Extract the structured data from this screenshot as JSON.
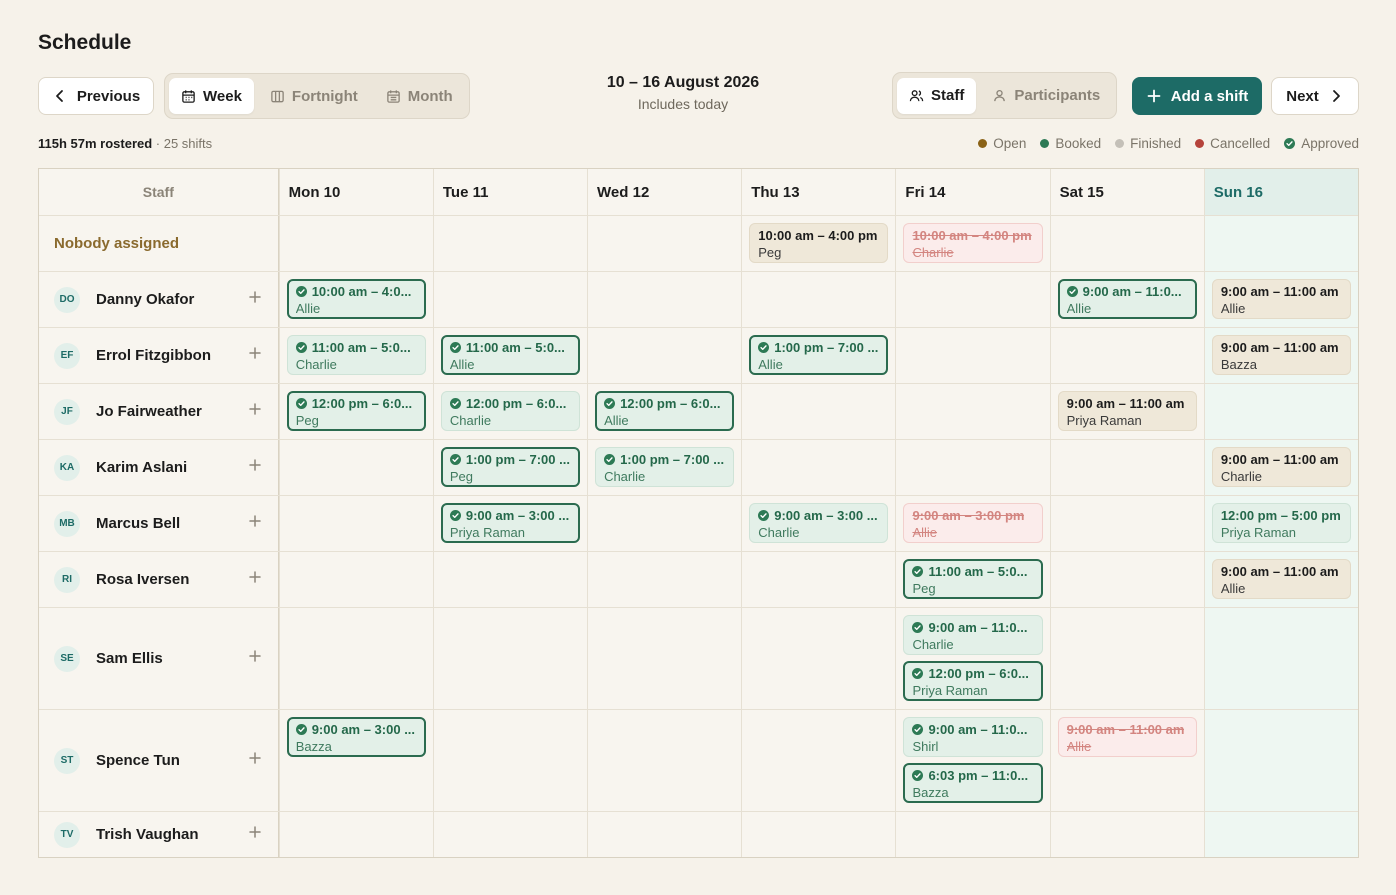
{
  "page": {
    "title": "Schedule"
  },
  "toolbar": {
    "previous_label": "Previous",
    "next_label": "Next",
    "views": [
      {
        "label": "Week",
        "icon": "calendar-icon",
        "active": true
      },
      {
        "label": "Fortnight",
        "icon": "columns-icon",
        "active": false
      },
      {
        "label": "Month",
        "icon": "calendar-grid-icon",
        "active": false
      }
    ],
    "range_title": "10 – 16 August 2026",
    "range_subtitle": "Includes today",
    "groupings": [
      {
        "label": "Staff",
        "icon": "users-icon",
        "active": true
      },
      {
        "label": "Participants",
        "icon": "user-icon",
        "active": false
      }
    ],
    "add_shift_label": "Add a shift"
  },
  "summary": {
    "hours": "115h 57m rostered",
    "shifts": " · 25 shifts"
  },
  "legend": [
    {
      "label": "Open",
      "color": "#8a6216",
      "kind": "dot"
    },
    {
      "label": "Booked",
      "color": "#2d7a55",
      "kind": "dot"
    },
    {
      "label": "Finished",
      "color": "#c4c0b8",
      "kind": "dot"
    },
    {
      "label": "Cancelled",
      "color": "#b5433b",
      "kind": "dot"
    },
    {
      "label": "Approved",
      "color": "#2d7a55",
      "kind": "check"
    }
  ],
  "grid": {
    "staff_header": "Staff",
    "days": [
      "Mon 10",
      "Tue 11",
      "Wed 12",
      "Thu 13",
      "Fri 14",
      "Sat 15",
      "Sun 16"
    ],
    "rows": [
      {
        "name": "Nobody assigned",
        "initials": "",
        "nobody": true,
        "height": 56,
        "cells": [
          [],
          [],
          [],
          [
            {
              "time": "10:00 am – 4:00 pm",
              "who": "Peg",
              "status": "open",
              "approved": false
            }
          ],
          [
            {
              "time": "10:00 am – 4:00 pm",
              "who": "Charlie",
              "status": "cancelled",
              "approved": false
            }
          ],
          [],
          []
        ]
      },
      {
        "name": "Danny Okafor",
        "initials": "DO",
        "height": 56,
        "cells": [
          [
            {
              "time": "10:00 am – 4:0...",
              "who": "Allie",
              "status": "booked",
              "approved": true,
              "selected": true
            }
          ],
          [],
          [],
          [],
          [],
          [
            {
              "time": "9:00 am – 11:0...",
              "who": "Allie",
              "status": "booked",
              "approved": true,
              "selected": true
            }
          ],
          [
            {
              "time": "9:00 am – 11:00 am",
              "who": "Allie",
              "status": "open",
              "approved": false
            }
          ]
        ]
      },
      {
        "name": "Errol Fitzgibbon",
        "initials": "EF",
        "height": 56,
        "cells": [
          [
            {
              "time": "11:00 am – 5:0...",
              "who": "Charlie",
              "status": "booked",
              "approved": true
            }
          ],
          [
            {
              "time": "11:00 am – 5:0...",
              "who": "Allie",
              "status": "booked",
              "approved": true,
              "selected": true
            }
          ],
          [],
          [
            {
              "time": "1:00 pm – 7:00 ...",
              "who": "Allie",
              "status": "booked",
              "approved": true,
              "selected": true
            }
          ],
          [],
          [],
          [
            {
              "time": "9:00 am – 11:00 am",
              "who": "Bazza",
              "status": "open",
              "approved": false
            }
          ]
        ]
      },
      {
        "name": "Jo Fairweather",
        "initials": "JF",
        "height": 56,
        "cells": [
          [
            {
              "time": "12:00 pm – 6:0...",
              "who": "Peg",
              "status": "booked",
              "approved": true,
              "selected": true
            }
          ],
          [
            {
              "time": "12:00 pm – 6:0...",
              "who": "Charlie",
              "status": "booked",
              "approved": true
            }
          ],
          [
            {
              "time": "12:00 pm – 6:0...",
              "who": "Allie",
              "status": "booked",
              "approved": true,
              "selected": true
            }
          ],
          [],
          [],
          [
            {
              "time": "9:00 am – 11:00 am",
              "who": "Priya Raman",
              "status": "open",
              "approved": false
            }
          ],
          []
        ]
      },
      {
        "name": "Karim Aslani",
        "initials": "KA",
        "height": 56,
        "cells": [
          [],
          [
            {
              "time": "1:00 pm – 7:00 ...",
              "who": "Peg",
              "status": "booked",
              "approved": true,
              "selected": true
            }
          ],
          [
            {
              "time": "1:00 pm – 7:00 ...",
              "who": "Charlie",
              "status": "booked",
              "approved": true
            }
          ],
          [],
          [],
          [],
          [
            {
              "time": "9:00 am – 11:00 am",
              "who": "Charlie",
              "status": "open",
              "approved": false
            }
          ]
        ]
      },
      {
        "name": "Marcus Bell",
        "initials": "MB",
        "height": 56,
        "cells": [
          [],
          [
            {
              "time": "9:00 am – 3:00 ...",
              "who": "Priya Raman",
              "status": "booked",
              "approved": true,
              "selected": true
            }
          ],
          [],
          [
            {
              "time": "9:00 am – 3:00 ...",
              "who": "Charlie",
              "status": "booked",
              "approved": true
            }
          ],
          [
            {
              "time": "9:00 am – 3:00 pm",
              "who": "Allie",
              "status": "cancelled",
              "approved": false
            }
          ],
          [],
          [
            {
              "time": "12:00 pm – 5:00 pm",
              "who": "Priya Raman",
              "status": "booked",
              "approved": false
            }
          ]
        ]
      },
      {
        "name": "Rosa Iversen",
        "initials": "RI",
        "height": 56,
        "cells": [
          [],
          [],
          [],
          [],
          [
            {
              "time": "11:00 am – 5:0...",
              "who": "Peg",
              "status": "booked",
              "approved": true,
              "selected": true
            }
          ],
          [],
          [
            {
              "time": "9:00 am – 11:00 am",
              "who": "Allie",
              "status": "open",
              "approved": false
            }
          ]
        ]
      },
      {
        "name": "Sam Ellis",
        "initials": "SE",
        "height": 102,
        "cells": [
          [],
          [],
          [],
          [],
          [
            {
              "time": "9:00 am – 11:0...",
              "who": "Charlie",
              "status": "booked",
              "approved": true
            },
            {
              "time": "12:00 pm – 6:0...",
              "who": "Priya Raman",
              "status": "booked",
              "approved": true,
              "selected": true
            }
          ],
          [],
          []
        ]
      },
      {
        "name": "Spence Tun",
        "initials": "ST",
        "height": 102,
        "cells": [
          [
            {
              "time": "9:00 am – 3:00 ...",
              "who": "Bazza",
              "status": "booked",
              "approved": true,
              "selected": true
            }
          ],
          [],
          [],
          [],
          [
            {
              "time": "9:00 am – 11:0...",
              "who": "Shirl",
              "status": "booked",
              "approved": true
            },
            {
              "time": "6:03 pm – 11:0...",
              "who": "Bazza",
              "status": "booked",
              "approved": true,
              "selected": true
            }
          ],
          [
            {
              "time": "9:00 am – 11:00 am",
              "who": "Allie",
              "status": "cancelled",
              "approved": false
            }
          ],
          []
        ]
      },
      {
        "name": "Trish Vaughan",
        "initials": "TV",
        "height": 46,
        "cells": [
          [],
          [],
          [],
          [],
          [],
          [],
          []
        ]
      }
    ]
  }
}
